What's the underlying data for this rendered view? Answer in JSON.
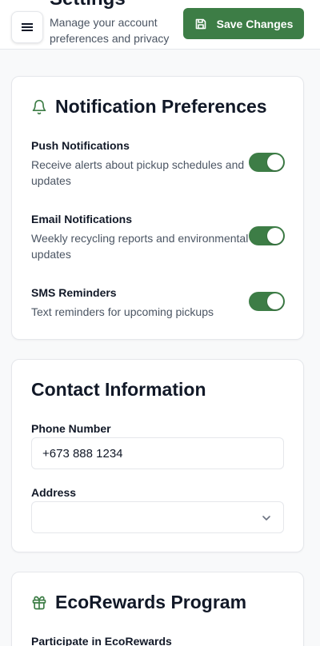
{
  "header": {
    "title": "Settings",
    "subtitle": "Manage your account preferences and privacy settings",
    "save_label": "Save Changes"
  },
  "notifications": {
    "title": "Notification Preferences",
    "items": [
      {
        "title": "Push Notifications",
        "description": "Receive alerts about pickup schedules and updates",
        "enabled": true
      },
      {
        "title": "Email Notifications",
        "description": "Weekly recycling reports and environmental updates",
        "enabled": true
      },
      {
        "title": "SMS Reminders",
        "description": "Text reminders for upcoming pickups",
        "enabled": true
      }
    ]
  },
  "contact": {
    "title": "Contact Information",
    "phone_label": "Phone Number",
    "phone_value": "+673 888 1234",
    "address_label": "Address",
    "address_value": ""
  },
  "rewards": {
    "title": "EcoRewards Program",
    "participate_label": "Participate in EcoRewards"
  },
  "colors": {
    "accent": "#3d7d46",
    "border": "#e5e7eb",
    "muted_text": "#4b5563"
  },
  "icons": {
    "menu": "menu-icon",
    "save": "save-icon",
    "notifications": "bell-icon",
    "address": "chevron-down-icon",
    "rewards": "gift-icon"
  }
}
